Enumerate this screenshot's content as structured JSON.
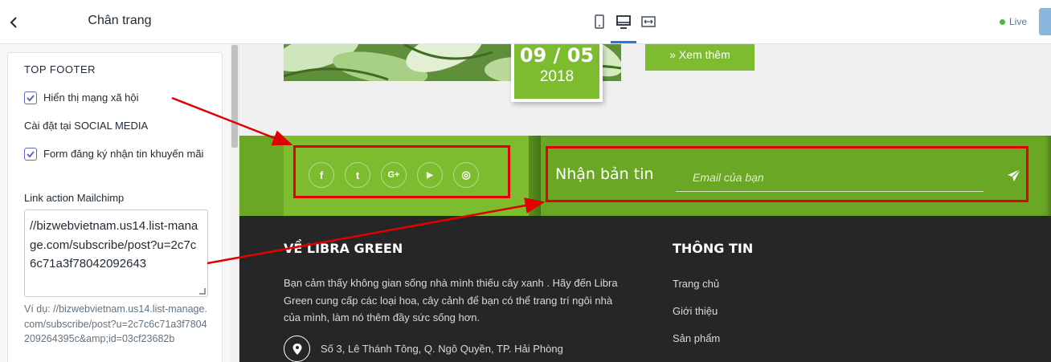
{
  "sidebar": {
    "title": "Chân trang",
    "section_title": "TOP FOOTER",
    "show_social": {
      "label": "Hiển thị mạng xã hội",
      "checked": true
    },
    "social_settings_note": "Cài đặt tại SOCIAL MEDIA",
    "newsletter_form": {
      "label": "Form đăng ký nhận tin khuyến mãi",
      "checked": true
    },
    "mailchimp_label": "Link action Mailchimp",
    "mailchimp_value": "//bizwebvietnam.us14.list-manage.com/subscribe/post?u=2c7c6c71a3f78042092643",
    "example_text": "Ví dụ: //bizwebvietnam.us14.list-manage.com/subscribe/post?u=2c7c6c71a3f7804209264395c&amp;id=03cf23682b"
  },
  "toolbar": {
    "devices": [
      "mobile-icon",
      "desktop-icon",
      "fullwidth-icon"
    ],
    "active_device": "desktop",
    "live_label": "Live",
    "accent_color": "#1f7ad6"
  },
  "preview": {
    "date_day": "09 / 05",
    "date_year": "2018",
    "more_button": "» Xem thêm",
    "social_icons": [
      "facebook-icon",
      "twitter-icon",
      "google-plus-icon",
      "youtube-icon",
      "instagram-icon"
    ],
    "social_glyphs": [
      "f",
      "t",
      "G+",
      "▶",
      "◎"
    ],
    "newsletter_title": "Nhận bản tin",
    "email_placeholder": "Email của bạn",
    "about_heading": "VỀ LIBRA GREEN",
    "about_text": "Bạn cảm thấy không gian sống nhà mình thiếu cây xanh . Hãy đến Libra Green cung cấp các loại hoa, cây cảnh để bạn có thể trang trí ngôi nhà của mình, làm nó thêm đầy sức sống hơn.",
    "address": "Số 3, Lê Thánh Tông, Q. Ngô Quyền, TP. Hải Phòng",
    "info_heading": "THÔNG TIN",
    "info_links": [
      "Trang chủ",
      "Giới thiệu",
      "Sản phẩm"
    ],
    "brand_green": "#7dbb2f",
    "dark_bg": "#262626"
  }
}
